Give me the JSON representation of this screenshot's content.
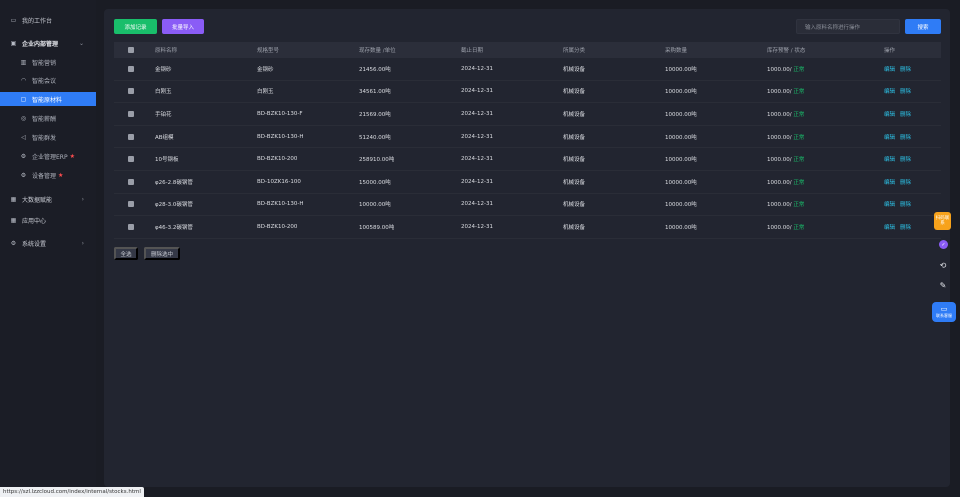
{
  "sidebar": {
    "workspace": "我的工作台",
    "enterprise": "企业内部管理",
    "items": [
      {
        "label": "智能营销",
        "icon": "chart-icon"
      },
      {
        "label": "智能会议",
        "icon": "headset-icon"
      },
      {
        "label": "智能原材料",
        "icon": "box-icon"
      },
      {
        "label": "智能薪酬",
        "icon": "coin-icon"
      },
      {
        "label": "智能群发",
        "icon": "megaphone-icon"
      },
      {
        "label": "企业管理ERP",
        "icon": "gear-icon"
      },
      {
        "label": "设备管理",
        "icon": "gear-icon"
      }
    ],
    "bigdata": "大数据赋能",
    "apps": "应用中心",
    "settings": "系统设置"
  },
  "toolbar": {
    "add_label": "添加记录",
    "import_label": "批量导入",
    "search_placeholder": "输入原料名称进行操作",
    "search_label": "搜索"
  },
  "table": {
    "headers": [
      "原料名称",
      "规格型号",
      "现存数量 /单位",
      "截止日期",
      "所属分类",
      "采购数量",
      "库存预警 / 状态",
      "操作"
    ],
    "rows": [
      {
        "name": "金钢砂",
        "spec": "金钢砂",
        "qty": "21456.00吨",
        "date": "2024-12-31",
        "cat": "机械设备",
        "purchase": "10000.00吨",
        "warn": "1000.00/",
        "status": "正常"
      },
      {
        "name": "白刚玉",
        "spec": "白刚玉",
        "qty": "34561.00吨",
        "date": "2024-12-31",
        "cat": "机械设备",
        "purchase": "10000.00吨",
        "warn": "1000.00/",
        "status": "正常"
      },
      {
        "name": "手铂花",
        "spec": "BD-BZK10-130-F",
        "qty": "21569.00吨",
        "date": "2024-12-31",
        "cat": "机械设备",
        "purchase": "10000.00吨",
        "warn": "1000.00/",
        "status": "正常"
      },
      {
        "name": "AB组模",
        "spec": "BD-BZK10-130-H",
        "qty": "51240.00吨",
        "date": "2024-12-31",
        "cat": "机械设备",
        "purchase": "10000.00吨",
        "warn": "1000.00/",
        "status": "正常"
      },
      {
        "name": "10号钢板",
        "spec": "BD-BZK10-200",
        "qty": "258910.00吨",
        "date": "2024-12-31",
        "cat": "机械设备",
        "purchase": "10000.00吨",
        "warn": "1000.00/",
        "status": "正常"
      },
      {
        "name": "φ26-2.8碳钢管",
        "spec": "BD-10ZK16-100",
        "qty": "15000.00吨",
        "date": "2024-12-31",
        "cat": "机械设备",
        "purchase": "10000.00吨",
        "warn": "1000.00/",
        "status": "正常"
      },
      {
        "name": "φ28-3.0碳钢管",
        "spec": "BD-BZK10-130-H",
        "qty": "10000.00吨",
        "date": "2024-12-31",
        "cat": "机械设备",
        "purchase": "10000.00吨",
        "warn": "1000.00/",
        "status": "正常"
      },
      {
        "name": "φ46-3.2碳钢管",
        "spec": "BD-BZK10-200",
        "qty": "100589.00吨",
        "date": "2024-12-31",
        "cat": "机械设备",
        "purchase": "10000.00吨",
        "warn": "1000.00/",
        "status": "正常"
      }
    ],
    "edit_label": "编辑",
    "delete_label": "删除"
  },
  "footer": {
    "select_all": "全选",
    "delete_selected": "删除选中"
  },
  "floating": {
    "orange_label": "扫码联系",
    "blue_label": "联系客服"
  },
  "status_url": "https://szl.lzzcloud.com/index/internal/stocks.html"
}
